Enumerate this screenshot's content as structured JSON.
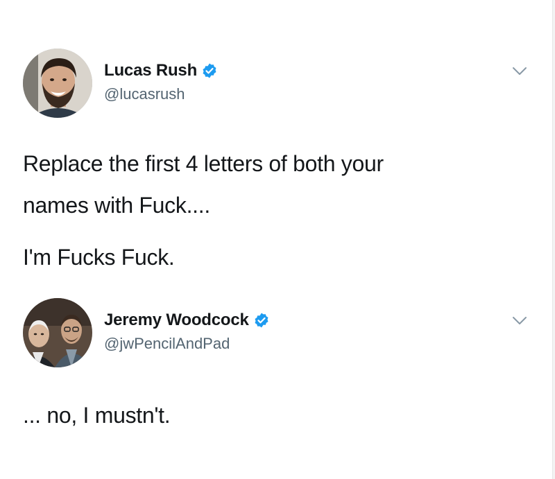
{
  "tweets": [
    {
      "author": {
        "name": "Lucas Rush",
        "handle": "@lucasrush",
        "verified": true,
        "avatar": "man-with-beard-smiling-photo"
      },
      "text_lines": [
        "Replace the first 4 letters of both your",
        "names with Fuck....",
        "I'm Fucks Fuck."
      ]
    },
    {
      "author": {
        "name": "Jeremy Woodcock",
        "handle": "@jwPencilAndPad",
        "verified": true,
        "avatar": "two-men-photo"
      },
      "text_lines": [
        "... no, I mustn't."
      ]
    }
  ],
  "colors": {
    "text": "#14171a",
    "handle": "#536471",
    "verified": "#1d9bf0",
    "chevron": "#8899a6",
    "background": "#ffffff"
  },
  "icons": [
    "verified-badge-icon",
    "chevron-down-icon"
  ]
}
